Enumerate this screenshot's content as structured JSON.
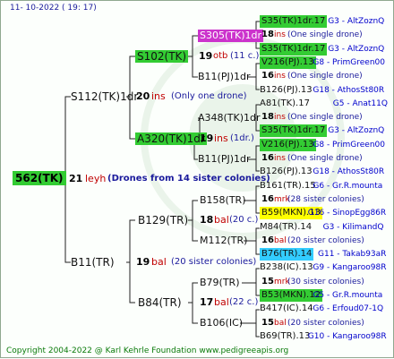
{
  "header": "11- 10-2022 ( 19: 17)",
  "footer": "Copyright 2004-2022 @ Karl Kehrle Foundation    www.pedigreeapis.org",
  "root": {
    "label": "562(TK)",
    "num": "21",
    "name": "leyh",
    "drones": "(Drones from 14 sister colonies)"
  },
  "colors": {
    "green_box": "#33cc33",
    "pink_box": "#cc33cc",
    "yellow_box": "#ffff00",
    "cyan_box": "#33ccff",
    "red": "#c00000",
    "navy": "#1a1a9c"
  },
  "gen1": {
    "sire": "S112(TK)1dr",
    "dam_num": "20",
    "dam_name": "ins",
    "dam_note": "(Only one drone)",
    "b11": "B11(TR)",
    "b11_num": "19",
    "b11_name": "bal",
    "b11_note": "(20 sister colonies)"
  },
  "gen2": {
    "s102": "S102(TK)",
    "s102_num": "19",
    "s102_name": "otb",
    "s102_note": "(11 c.)",
    "a320": "A320(TK)1dr",
    "a320_num": "19",
    "a320_name": "ins",
    "a320_note": "(1dr.)",
    "b129": "B129(TR)",
    "b129_num": "18",
    "b129_name": "bal",
    "b129_note": "(20 c.)",
    "b84": "B84(TR)",
    "b84_num": "17",
    "b84_name": "bal",
    "b84_note": "(22 c.)"
  },
  "gen3": {
    "s305": "S305(TK)1dr",
    "s305_num": "18",
    "s305_name": "ins",
    "s305_note": "(One single drone)",
    "b11pj_a": "B11(PJ)1dr",
    "a348": "A348(TK)1dr",
    "a348_num": "18",
    "a348_name": "ins",
    "a348_note": "(One single drone)",
    "b11pj_b": "B11(PJ)1dr",
    "b158": "B158(TR)",
    "b158_num": "16",
    "b158_name": "mrk",
    "b158_note": "(28 sister colonies)",
    "m112": "M112(TR)",
    "b79": "B79(TR)",
    "b79_num": "15",
    "b79_name": "mrk",
    "b79_note": "(30 sister colonies)",
    "b106": "B106(IC)"
  },
  "rows": [
    {
      "label": "S35(TK)1dr.17",
      "box": "green",
      "gen": "G3 - AltZoznQ"
    },
    {
      "label": "18",
      "name": "ins",
      "note": "(One single drone)"
    },
    {
      "label": "S35(TK)1dr.17",
      "box": "green",
      "gen": "G3 - AltZoznQ"
    },
    {
      "label": "V216(PJ).13",
      "box": "green",
      "gen": "G8 - PrimGreen00"
    },
    {
      "label": "16",
      "name": "ins",
      "note": "(One single drone)"
    },
    {
      "label": "B126(PJ).13",
      "gen": "G18 - AthosSt80R"
    },
    {
      "label": "A81(TK).17",
      "gen": "G5 - Anat11Q"
    },
    {
      "label": "18",
      "name": "ins",
      "note": "(One single drone)"
    },
    {
      "label": "S35(TK)1dr.17",
      "box": "green",
      "gen": "G3 - AltZoznQ"
    },
    {
      "label": "V216(PJ).13",
      "box": "green",
      "gen": "G8 - PrimGreen00"
    },
    {
      "label": "16",
      "name": "ins",
      "note": "(One single drone)"
    },
    {
      "label": "B126(PJ).13",
      "gen": "G18 - AthosSt80R"
    },
    {
      "label": "B161(TR).15",
      "gen": "G6 - Gr.R.mounta"
    },
    {
      "label": "16",
      "name": "mrk",
      "note": "(28 sister colonies)"
    },
    {
      "label": "B59(MKN).13",
      "box": "yellow",
      "gen": "G16 - SinopEgg86R"
    },
    {
      "label": "M84(TR).14",
      "gen": "G3 - KilimandQ"
    },
    {
      "label": "16",
      "name": "bal",
      "note": "(20 sister colonies)"
    },
    {
      "label": "B76(TR).14",
      "box": "cyan",
      "gen": "G11 - Takab93aR"
    },
    {
      "label": "B238(IC).13",
      "gen": "G9 - Kangaroo98R"
    },
    {
      "label": "15",
      "name": "mrk",
      "note": "(30 sister colonies)"
    },
    {
      "label": "B53(MKN).12",
      "box": "green",
      "gen": "G5 - Gr.R.mounta"
    },
    {
      "label": "B417(IC).14",
      "gen": "G6 - Erfoud07-1Q"
    },
    {
      "label": "15",
      "name": "bal",
      "note": "(20 sister colonies)"
    },
    {
      "label": "B69(TR).13",
      "gen": "G10 - Kangaroo98R"
    }
  ]
}
